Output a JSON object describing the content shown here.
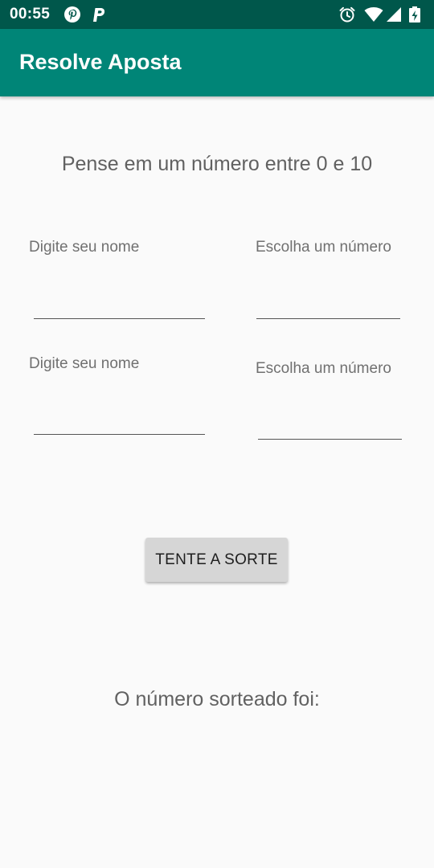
{
  "status_bar": {
    "time": "00:55",
    "left_icons": [
      "pinterest-icon",
      "parking-app-icon"
    ],
    "right_icons": [
      "alarm-icon",
      "wifi-icon",
      "signal-icon",
      "battery-charging-icon"
    ]
  },
  "app_bar": {
    "title": "Resolve Aposta",
    "color": "#008577",
    "status_color": "#00574b"
  },
  "main": {
    "instruction": "Pense em um número entre 0 e 10",
    "rows": [
      {
        "name_hint": "Digite seu nome",
        "name_value": "",
        "number_hint": "Escolha um número",
        "number_value": ""
      },
      {
        "name_hint": "Digite seu nome",
        "name_value": "",
        "number_hint": "Escolha um número",
        "number_value": ""
      }
    ],
    "button_label": "TENTE A SORTE",
    "result_label": "O número sorteado foi:"
  }
}
